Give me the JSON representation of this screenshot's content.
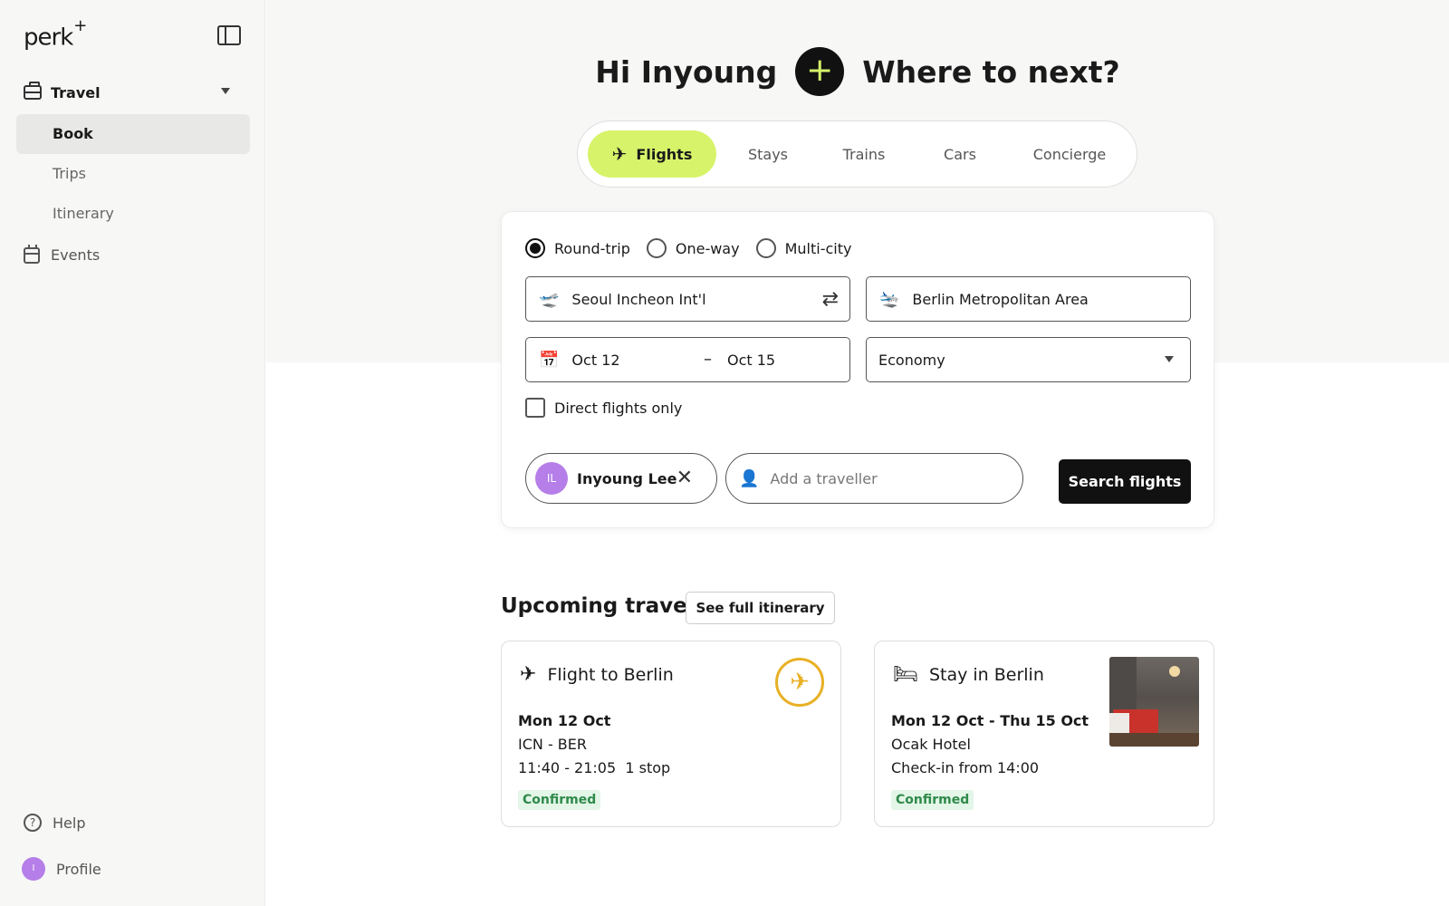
{
  "sidebar": {
    "logo": "perk",
    "logo_sup": "+",
    "travel_label": "Travel",
    "sub_items": [
      "Book",
      "Trips",
      "Itinerary"
    ],
    "events_label": "Events",
    "help_label": "Help",
    "profile_label": "Profile",
    "profile_initial": "I"
  },
  "hero": {
    "greeting": "Hi Inyoung",
    "plus": "+",
    "question": "Where to next?"
  },
  "tabs": [
    "Flights",
    "Stays",
    "Trains",
    "Cars",
    "Concierge"
  ],
  "search": {
    "trip_types": [
      "Round-trip",
      "One-way",
      "Multi-city"
    ],
    "selected_trip_type": "Round-trip",
    "origin": "Seoul Incheon Int'l",
    "destination": "Berlin Metropolitan Area",
    "depart_date": "Oct 12",
    "return_date": "Oct 15",
    "cabin_class": "Economy",
    "direct_only_label": "Direct flights only",
    "traveller_initials": "IL",
    "traveller_name": "Inyoung Lee",
    "add_traveller_placeholder": "Add a traveller",
    "search_button": "Search flights"
  },
  "upcoming": {
    "title": "Upcoming travel",
    "itinerary_button": "See full itinerary",
    "flight": {
      "title": "Flight to Berlin",
      "date": "Mon 12 Oct",
      "route": "ICN - BER",
      "times": "11:40 - 21:05  1 stop",
      "status": "Confirmed"
    },
    "stay": {
      "title": "Stay in Berlin",
      "dates": "Mon 12 Oct - Thu 15 Oct",
      "hotel": "Ocak Hotel",
      "checkin": "Check-in from 14:00",
      "status": "Confirmed"
    }
  },
  "colors": {
    "accent": "#d7f36a",
    "avatar": "#b57ee8",
    "confirmed_bg": "#e3f6e8",
    "confirmed_text": "#2f8a4a",
    "airline": "#e8b025"
  }
}
